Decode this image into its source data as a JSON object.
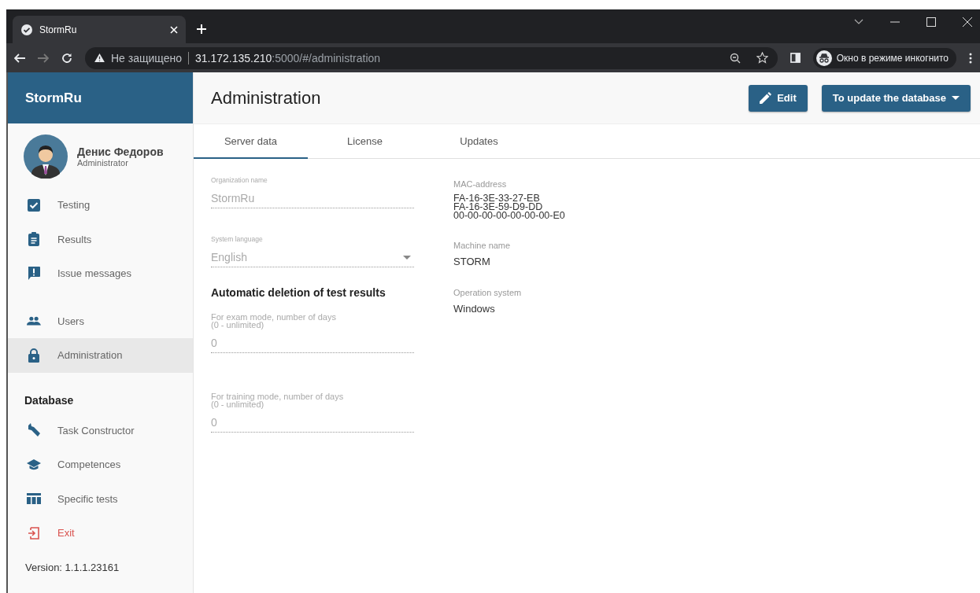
{
  "browser": {
    "tab_title": "StormRu",
    "security": "Не защищено",
    "url_host": "31.172.135.210",
    "url_rest": ":5000/#/administration",
    "incognito": "Окно в режиме инкогнито"
  },
  "sidebar": {
    "brand": "StormRu",
    "user": {
      "name": "Денис Федоров",
      "role": "Administrator"
    },
    "sections": [
      {
        "items": [
          {
            "label": "Testing",
            "selected": false,
            "kind": "normal"
          },
          {
            "label": "Results",
            "selected": false,
            "kind": "normal"
          },
          {
            "label": "Issue messages",
            "selected": false,
            "kind": "normal"
          }
        ]
      },
      {
        "items": [
          {
            "label": "Users",
            "selected": false,
            "kind": "normal"
          },
          {
            "label": "Administration",
            "selected": true,
            "kind": "normal"
          }
        ]
      },
      {
        "title": "Database",
        "items": [
          {
            "label": "Task Constructor",
            "selected": false,
            "kind": "normal"
          },
          {
            "label": "Competences",
            "selected": false,
            "kind": "normal"
          },
          {
            "label": "Specific tests",
            "selected": false,
            "kind": "normal"
          },
          {
            "label": "Exit",
            "selected": false,
            "kind": "exit"
          }
        ]
      }
    ],
    "version": "Version: 1.1.1.23161"
  },
  "header": {
    "title": "Administration",
    "buttons": [
      {
        "label": "Edit",
        "kind": "edit"
      },
      {
        "label": "To update the database",
        "kind": "dropdown"
      }
    ]
  },
  "tabs": [
    {
      "label": "Server data",
      "selected": true
    },
    {
      "label": "License",
      "selected": false
    },
    {
      "label": "Updates",
      "selected": false
    }
  ],
  "form": {
    "organization": {
      "label": "Organization name",
      "value": "StormRu"
    },
    "language": {
      "label": "System language",
      "value": "English"
    },
    "deletion_heading": "Automatic deletion of test results",
    "deletion_fields": [
      {
        "label": "For exam mode, number of days",
        "hint": "(0 - unlimited)",
        "value": "0"
      },
      {
        "label": "For training mode, number of days",
        "hint": "(0 - unlimited)",
        "value": "0"
      }
    ]
  },
  "info": [
    {
      "label": "MAC-address",
      "values": [
        "FA-16-3E-33-27-EB",
        "FA-16-3E-59-D9-DD",
        "00-00-00-00-00-00-00-E0"
      ]
    },
    {
      "label": "Machine name",
      "values": [
        "STORM"
      ]
    },
    {
      "label": "Operation system",
      "values": [
        "Windows"
      ]
    }
  ]
}
